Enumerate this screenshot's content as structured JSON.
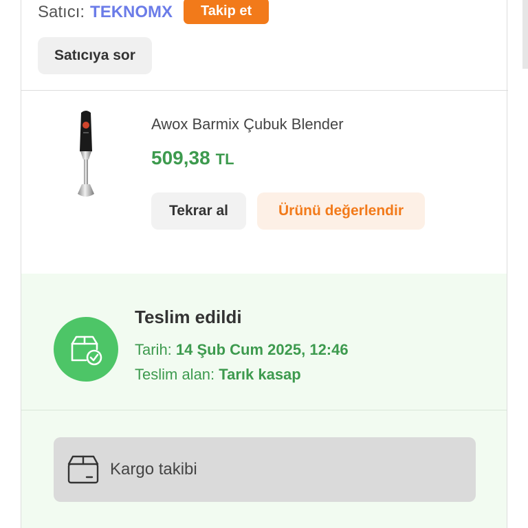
{
  "seller": {
    "prefix": "Satıcı:",
    "name": "TEKNOMX",
    "follow_label": "Takip et",
    "ask_label": "Satıcıya sor"
  },
  "product": {
    "name": "Awox Barmix Çubuk Blender",
    "price": "509,38",
    "currency": "TL",
    "buy_again_label": "Tekrar al",
    "rate_label": "Ürünü değerlendir",
    "image_icon": "hand-blender"
  },
  "delivery": {
    "status": "Teslim edildi",
    "date_label": "Tarih:",
    "date_value": "14 Şub Cum 2025, 12:46",
    "receiver_label": "Teslim alan:",
    "receiver_value": "Tarık kasap",
    "icon": "box-check-icon"
  },
  "cargo": {
    "label": "Kargo takibi",
    "icon": "package-icon"
  },
  "colors": {
    "brand_orange": "#f27a1a",
    "seller_link": "#6b7ce8",
    "price_green": "#3d9a4e",
    "delivered_green": "#4dc567",
    "delivery_bg": "#f2fbf1"
  }
}
